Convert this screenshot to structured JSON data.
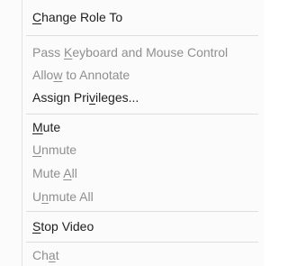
{
  "menu": {
    "items": [
      {
        "pre": "",
        "mn": "C",
        "post": "hange Role To",
        "enabled": true
      },
      {
        "pre": "Pass ",
        "mn": "K",
        "post": "eyboard and Mouse Control",
        "enabled": false
      },
      {
        "pre": "Allo",
        "mn": "w",
        "post": " to Annotate",
        "enabled": false
      },
      {
        "pre": "Assign Pri",
        "mn": "v",
        "post": "ileges...",
        "enabled": true
      },
      {
        "pre": "",
        "mn": "M",
        "post": "ute",
        "enabled": true
      },
      {
        "pre": "",
        "mn": "U",
        "post": "nmute",
        "enabled": false
      },
      {
        "pre": "Mute ",
        "mn": "A",
        "post": "ll",
        "enabled": false
      },
      {
        "pre": "U",
        "mn": "n",
        "post": "mute All",
        "enabled": false
      },
      {
        "pre": "",
        "mn": "S",
        "post": "top Video",
        "enabled": true
      },
      {
        "pre": "Ch",
        "mn": "a",
        "post": "t",
        "enabled": false
      }
    ]
  }
}
